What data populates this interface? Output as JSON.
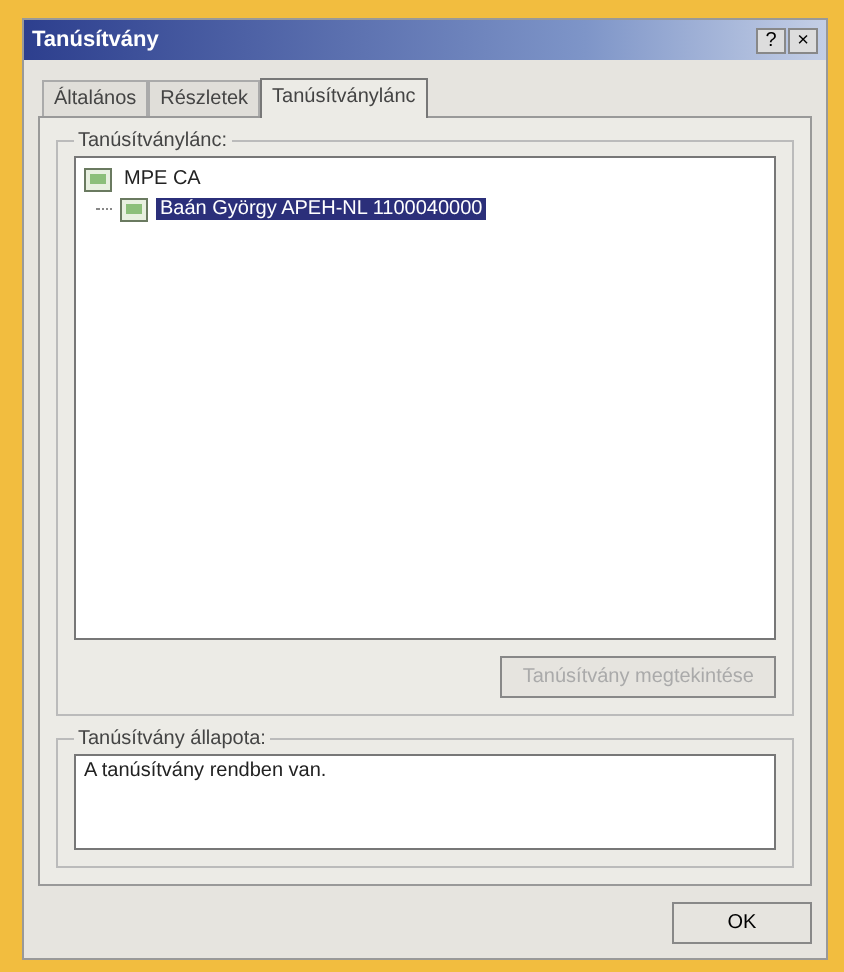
{
  "window": {
    "title": "Tanúsítvány",
    "buttons": [
      "?",
      "×"
    ]
  },
  "tabs": [
    {
      "label": "Általános",
      "selected": false
    },
    {
      "label": "Részletek",
      "selected": false
    },
    {
      "label": "Tanúsítványlánc",
      "selected": true
    }
  ],
  "chain": {
    "label": "Tanúsítványlánc:",
    "tree": [
      {
        "label": "MPE CA",
        "selected": false,
        "children": [
          {
            "label": "Baán György APEH-NL 1100040000",
            "selected": true
          }
        ]
      }
    ],
    "view_button": {
      "label": "Tanúsítvány megtekintése",
      "disabled": true
    }
  },
  "status": {
    "label": "Tanúsítvány állapota:",
    "value": "A tanúsítvány rendben van."
  },
  "ok_button": "OK"
}
